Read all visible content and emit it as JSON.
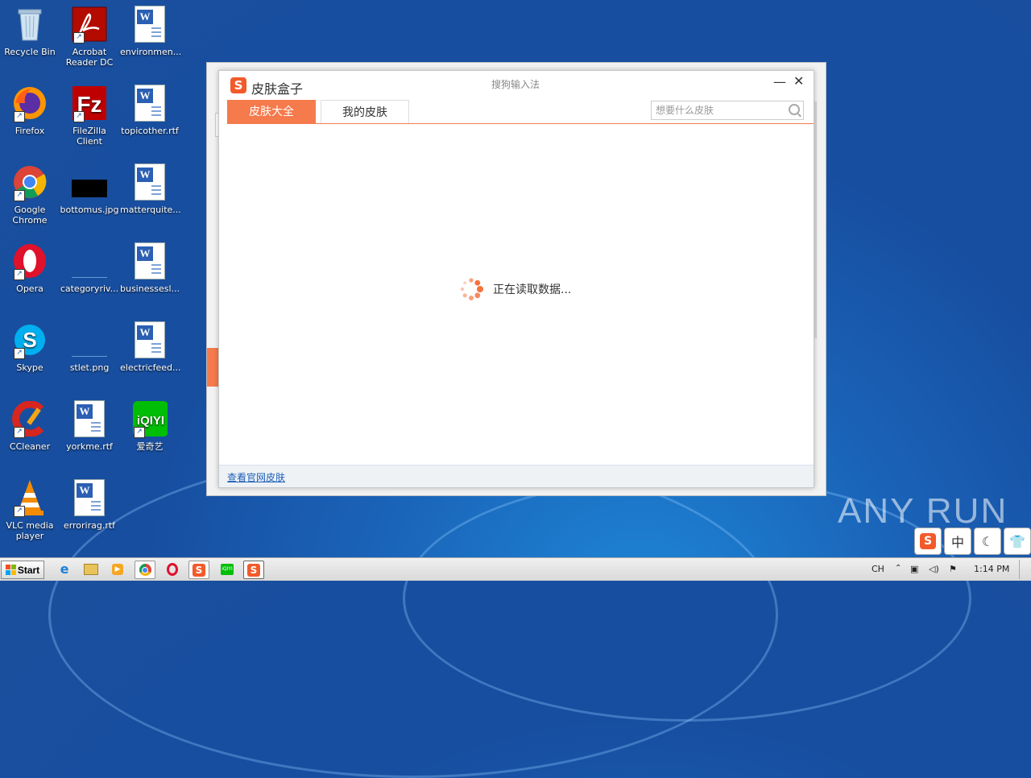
{
  "desktop": {
    "icons": [
      {
        "label": "Recycle Bin"
      },
      {
        "label": "Acrobat Reader DC"
      },
      {
        "label": "environmen..."
      },
      {
        "label": "Firefox"
      },
      {
        "label": "FileZilla Client"
      },
      {
        "label": "topicother.rtf"
      },
      {
        "label": "Google Chrome"
      },
      {
        "label": "bottomus.jpg"
      },
      {
        "label": "matterquite..."
      },
      {
        "label": "Opera"
      },
      {
        "label": "categoryriv..."
      },
      {
        "label": "businessesl..."
      },
      {
        "label": "Skype"
      },
      {
        "label": "stlet.png"
      },
      {
        "label": "electricfeed..."
      },
      {
        "label": "CCleaner"
      },
      {
        "label": "yorkme.rtf"
      },
      {
        "label": "爱奇艺"
      },
      {
        "label": "VLC media player"
      },
      {
        "label": "errorirag.rtf"
      }
    ]
  },
  "dialog": {
    "title": "皮肤盒子",
    "center_title": "搜狗输入法",
    "minimize_glyph": "—",
    "close_glyph": "✕",
    "tabs": [
      {
        "label": "皮肤大全"
      },
      {
        "label": "我的皮肤"
      }
    ],
    "search_placeholder": "想要什么皮肤",
    "loading_text": "正在读取数据...",
    "footer_link": "查看官网皮肤"
  },
  "watermark": "ANY RUN",
  "ime_toolbar": {
    "lang": "中"
  },
  "taskbar": {
    "start_label": "Start",
    "language": "CH",
    "clock": "1:14 PM"
  },
  "colors": {
    "accent": "#f57a4c",
    "sogou_red": "#f25a2a",
    "desktop_blue": "#1a5aab"
  }
}
